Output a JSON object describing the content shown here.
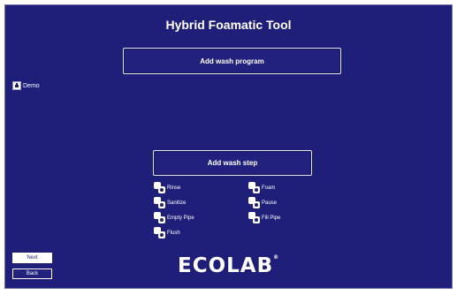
{
  "app": {
    "title": "Hybrid Foamatic Tool"
  },
  "buttons": {
    "add_program": "Add wash program",
    "add_step": "Add wash step",
    "next": "Next",
    "back": "Back"
  },
  "programs": [
    {
      "label": "Demo",
      "icon": "program-icon"
    }
  ],
  "steps": [
    {
      "label": "Rinse",
      "icon": "rinse-step-icon"
    },
    {
      "label": "Foam",
      "icon": "foam-step-icon"
    },
    {
      "label": "Sanitize",
      "icon": "sanitize-step-icon"
    },
    {
      "label": "Pause",
      "icon": "pause-step-icon"
    },
    {
      "label": "Empty Pipe",
      "icon": "empty-pipe-step-icon"
    },
    {
      "label": "Fill Pipe",
      "icon": "fill-pipe-step-icon"
    },
    {
      "label": "Flush",
      "icon": "flush-step-icon"
    }
  ],
  "logo": {
    "text": "ECOLAB",
    "mark": "®"
  },
  "colors": {
    "background": "#1f1f7a",
    "text": "#ffffff"
  }
}
